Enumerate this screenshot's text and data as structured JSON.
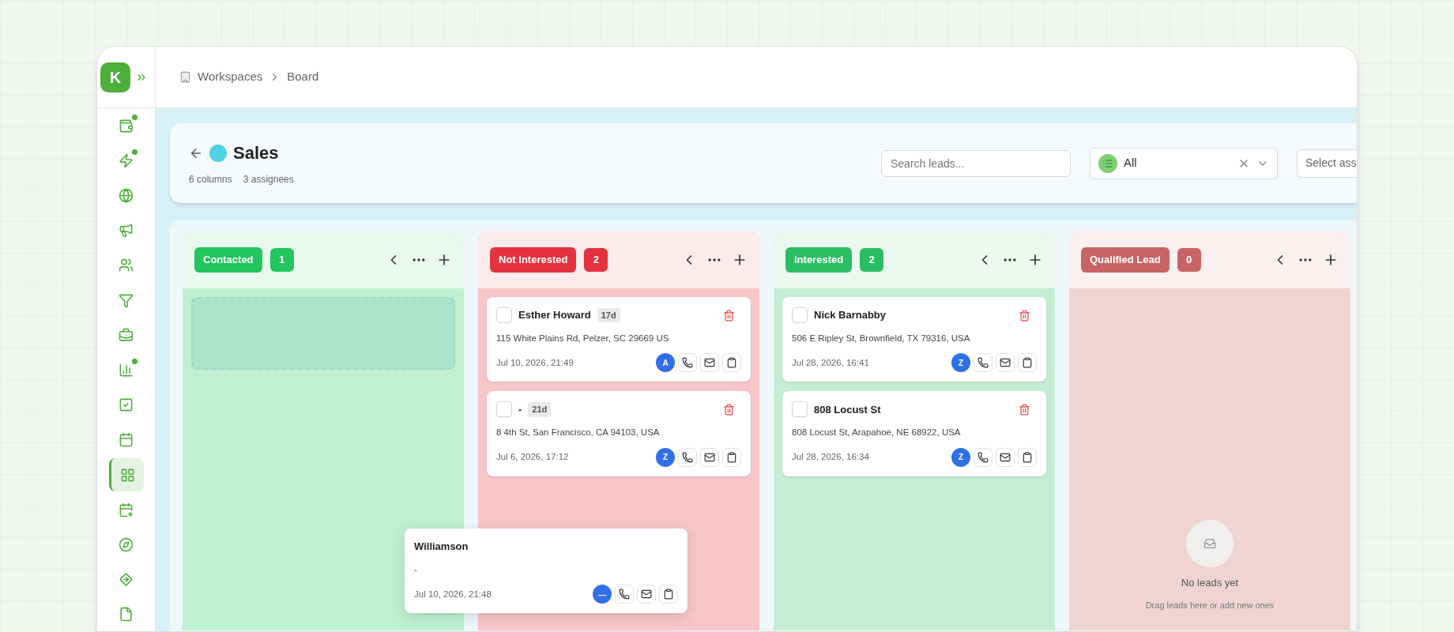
{
  "logo": {
    "text": "K"
  },
  "breadcrumb": [
    "Workspaces",
    "Board"
  ],
  "sidebar": {
    "items": [
      {
        "selected": false,
        "dot": true
      },
      {
        "selected": false,
        "dot": true
      },
      {
        "selected": false,
        "dot": false
      },
      {
        "selected": false,
        "dot": false
      },
      {
        "selected": false,
        "dot": false
      },
      {
        "selected": false,
        "dot": false
      },
      {
        "selected": false,
        "dot": false
      },
      {
        "selected": false,
        "dot": true
      },
      {
        "selected": false,
        "dot": false
      },
      {
        "selected": false,
        "dot": false
      },
      {
        "selected": true,
        "dot": false
      },
      {
        "selected": false,
        "dot": false
      },
      {
        "selected": false,
        "dot": false
      },
      {
        "selected": false,
        "dot": false
      },
      {
        "selected": false,
        "dot": false
      }
    ]
  },
  "board_header": {
    "title": "Sales",
    "color": "#4fd1e5",
    "meta": [
      "6 columns",
      "3 assignees"
    ],
    "search": {
      "placeholder": "Search leads..."
    },
    "filter": {
      "value": "All"
    },
    "assignee": {
      "placeholder": "Select ass"
    }
  },
  "columns": [
    {
      "title": "Contacted",
      "count": "1",
      "color": "#22c55e",
      "drop_zone": true
    },
    {
      "title": "Not Interested",
      "count": "2",
      "color": "#e5323f",
      "drop_zone": false,
      "cards": [
        {
          "name": "Esther Howard",
          "age": "17d",
          "address": "115 White Plains Rd, Pelzer, SC 29669 US",
          "date": "Jul 10, 2026, 21:49",
          "assignee": "A",
          "checked": false
        },
        {
          "name": "-",
          "age": "21d",
          "address": "8 4th St, San Francisco, CA 94103, USA",
          "date": "Jul 6, 2026, 17:12",
          "assignee": "Z",
          "checked": false
        }
      ]
    },
    {
      "title": "Interested",
      "count": "2",
      "color": "#2bbd64",
      "drop_zone": false,
      "cards": [
        {
          "name": "Nick Barnabby",
          "address": "506 E Ripley St, Brownfield, TX 79316, USA",
          "date": "Jul 28, 2026, 16:41",
          "assignee": "Z",
          "checked": false
        },
        {
          "name": "808 Locust St",
          "address": "808 Locust St, Arapahoe, NE 68922, USA",
          "date": "Jul 28, 2026, 16:34",
          "assignee": "Z",
          "checked": false
        }
      ]
    },
    {
      "title": "Qualified Lead",
      "count": "0",
      "color": "#c86464",
      "drop_zone": false,
      "empty": {
        "title": "No leads yet",
        "hint": "Drag leads here or add new ones"
      }
    }
  ],
  "dragging_card": {
    "name": "Williamson",
    "address": "-",
    "date": "Jul 10, 2026, 21:48",
    "assignee": "---"
  }
}
